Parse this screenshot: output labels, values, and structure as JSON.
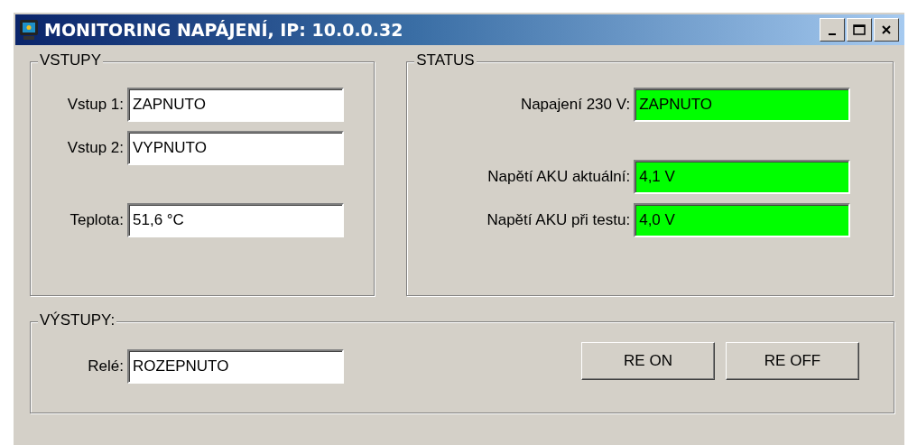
{
  "window": {
    "title": "MONITORING NAPÁJENÍ, IP: 10.0.0.32"
  },
  "inputs": {
    "title": "VSTUPY",
    "fields": [
      {
        "label": "Vstup 1:",
        "value": "ZAPNUTO"
      },
      {
        "label": "Vstup 2:",
        "value": "VYPNUTO"
      }
    ],
    "temperature": {
      "label": "Teplota:",
      "value": "51,6 °C"
    }
  },
  "status": {
    "title": "STATUS",
    "power": {
      "label": "Napajení 230 V:",
      "value": "ZAPNUTO"
    },
    "battery": [
      {
        "label": "Napětí AKU aktuální:",
        "value": "4,1 V"
      },
      {
        "label": "Napětí AKU při testu:",
        "value": "4,0 V"
      }
    ]
  },
  "outputs": {
    "title": "VÝSTUPY:",
    "relay": {
      "label": "Relé:",
      "value": "ROZEPNUTO"
    },
    "buttons": [
      "RE ON",
      "RE OFF"
    ]
  }
}
